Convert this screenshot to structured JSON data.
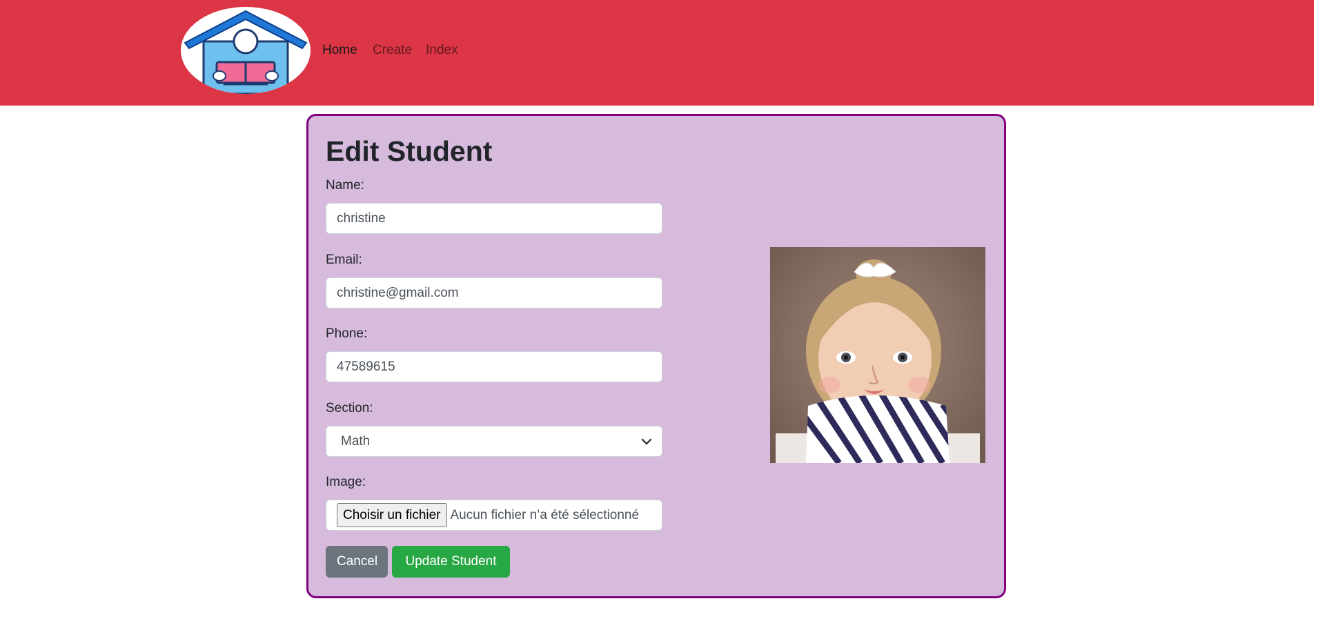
{
  "nav": {
    "logo_icon": "school-reader-logo-icon",
    "links": [
      {
        "label": "Home",
        "active": true
      },
      {
        "label": "Create",
        "active": false
      },
      {
        "label": "Index",
        "active": false
      }
    ]
  },
  "form": {
    "title": "Edit Student",
    "name": {
      "label": "Name:",
      "value": "christine"
    },
    "email": {
      "label": "Email:",
      "value": "christine@gmail.com"
    },
    "phone": {
      "label": "Phone:",
      "value": "47589615"
    },
    "section": {
      "label": "Section:",
      "value": "Math",
      "icon": "chevron-down-icon"
    },
    "image": {
      "label": "Image:",
      "button": "Choisir un fichier",
      "status": "Aucun fichier n’a été sélectionné"
    },
    "cancel_label": "Cancel",
    "update_label": "Update Student"
  },
  "photo": {
    "alt": "student photo"
  },
  "colors": {
    "navbar": "#dc3545",
    "card_bg": "#d6bbdd",
    "card_border": "#800080",
    "cancel_btn": "#6c757d",
    "update_btn": "#28a745"
  }
}
